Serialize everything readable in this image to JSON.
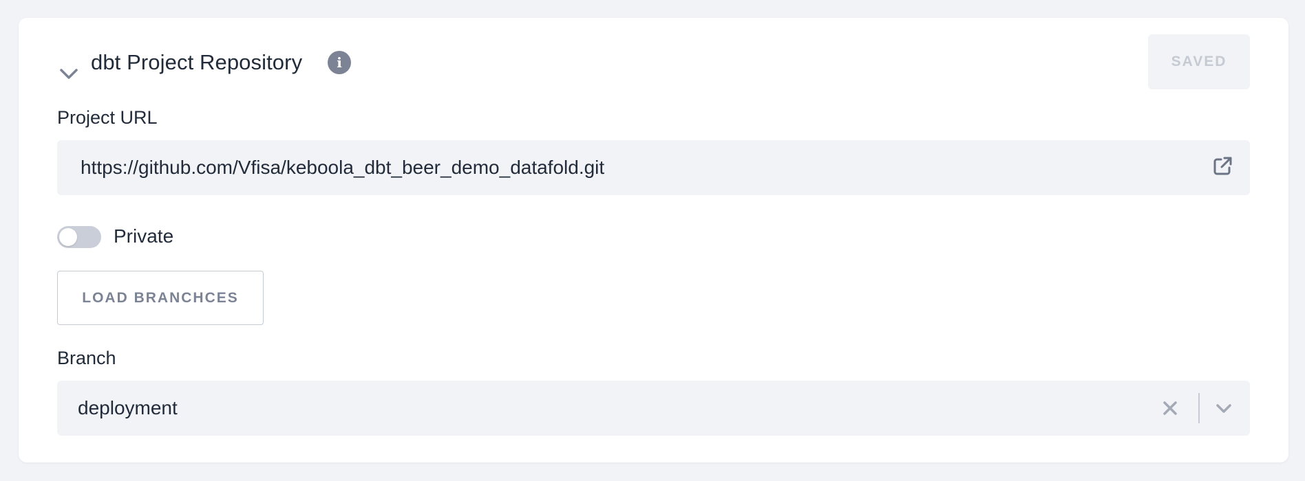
{
  "section": {
    "title": "dbt Project Repository",
    "saved_label": "SAVED"
  },
  "project_url": {
    "label": "Project URL",
    "value": "https://github.com/Vfisa/keboola_dbt_beer_demo_datafold.git"
  },
  "private_toggle": {
    "label": "Private",
    "checked": false
  },
  "load_branches": {
    "label": "LOAD BRANCHCES"
  },
  "branch": {
    "label": "Branch",
    "selected": "deployment"
  },
  "icons": {
    "collapse": "chevron-down-icon",
    "info": "info-icon",
    "external_link": "external-link-icon",
    "clear": "close-icon",
    "dropdown": "chevron-down-icon"
  },
  "colors": {
    "background": "#f2f3f7",
    "card": "#ffffff",
    "text": "#222b3a",
    "muted": "#7b8394",
    "disabled_text": "#c5cad3",
    "field_bg": "#f2f3f7"
  }
}
